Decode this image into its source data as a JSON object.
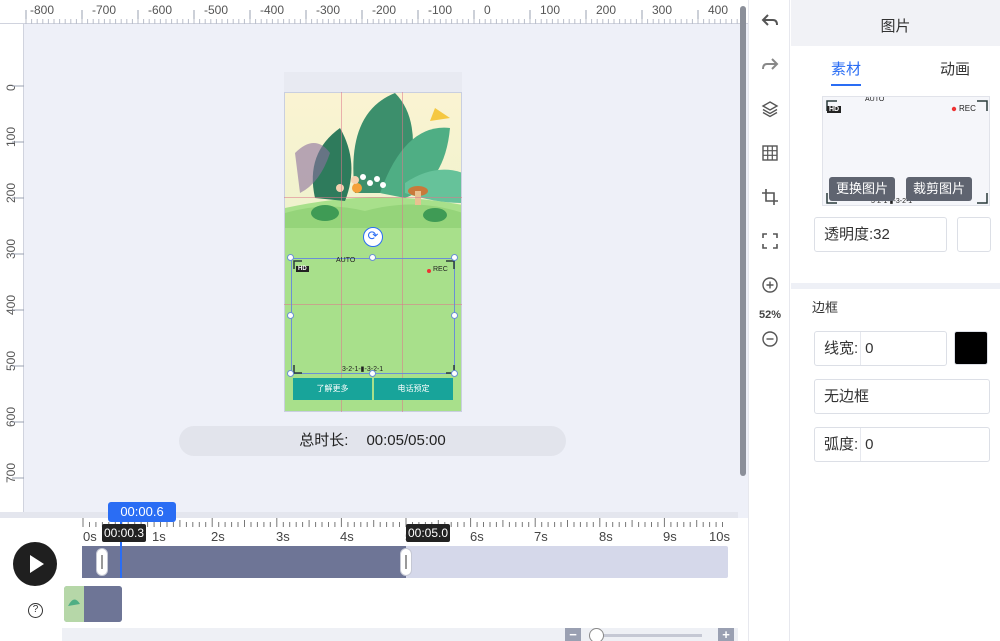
{
  "canvas": {
    "ruler_top": [
      "-800",
      "-700",
      "-600",
      "-500",
      "-400",
      "-300",
      "-200",
      "-100",
      "0",
      "100",
      "200",
      "300",
      "400"
    ],
    "ruler_left": [
      "0",
      "100",
      "200",
      "300",
      "400",
      "500",
      "600",
      "700"
    ],
    "phone": {
      "rec_label": "REC",
      "hd_label": "HD",
      "auto_label": "AUTO",
      "counter_label": "3-2-1-▮-3-2-1",
      "btn_learn_more": "了解更多",
      "btn_call": "电话预定"
    },
    "duration_label": "总时长:",
    "duration_value": "00:05/05:00",
    "zoom_percent": "52%"
  },
  "panel": {
    "title": "图片",
    "tab_material": "素材",
    "tab_animation": "动画",
    "replace_image": "更换图片",
    "crop_image": "裁剪图片",
    "thumb_rec": "REC",
    "thumb_hd": "HD",
    "thumb_auto": "AUTO",
    "thumb_counter": "3-2-1-▮-3-2-1",
    "opacity_label": "透明度:",
    "opacity_value": "32",
    "border_heading": "边框",
    "line_width_label": "线宽:",
    "line_width_value": "0",
    "border_style_value": "无边框",
    "radius_label": "弧度:",
    "radius_value": "0",
    "border_color": "#000000"
  },
  "timeline": {
    "labels": [
      "0s",
      "1s",
      "2s",
      "3s",
      "4s",
      "5s",
      "6s",
      "7s",
      "8s",
      "9s",
      "10s"
    ],
    "playhead_time": "00:00.6",
    "clip_start": "00:00.3",
    "clip_end": "00:05.0",
    "help": "?",
    "zoom_minus": "−",
    "zoom_plus": "+"
  }
}
